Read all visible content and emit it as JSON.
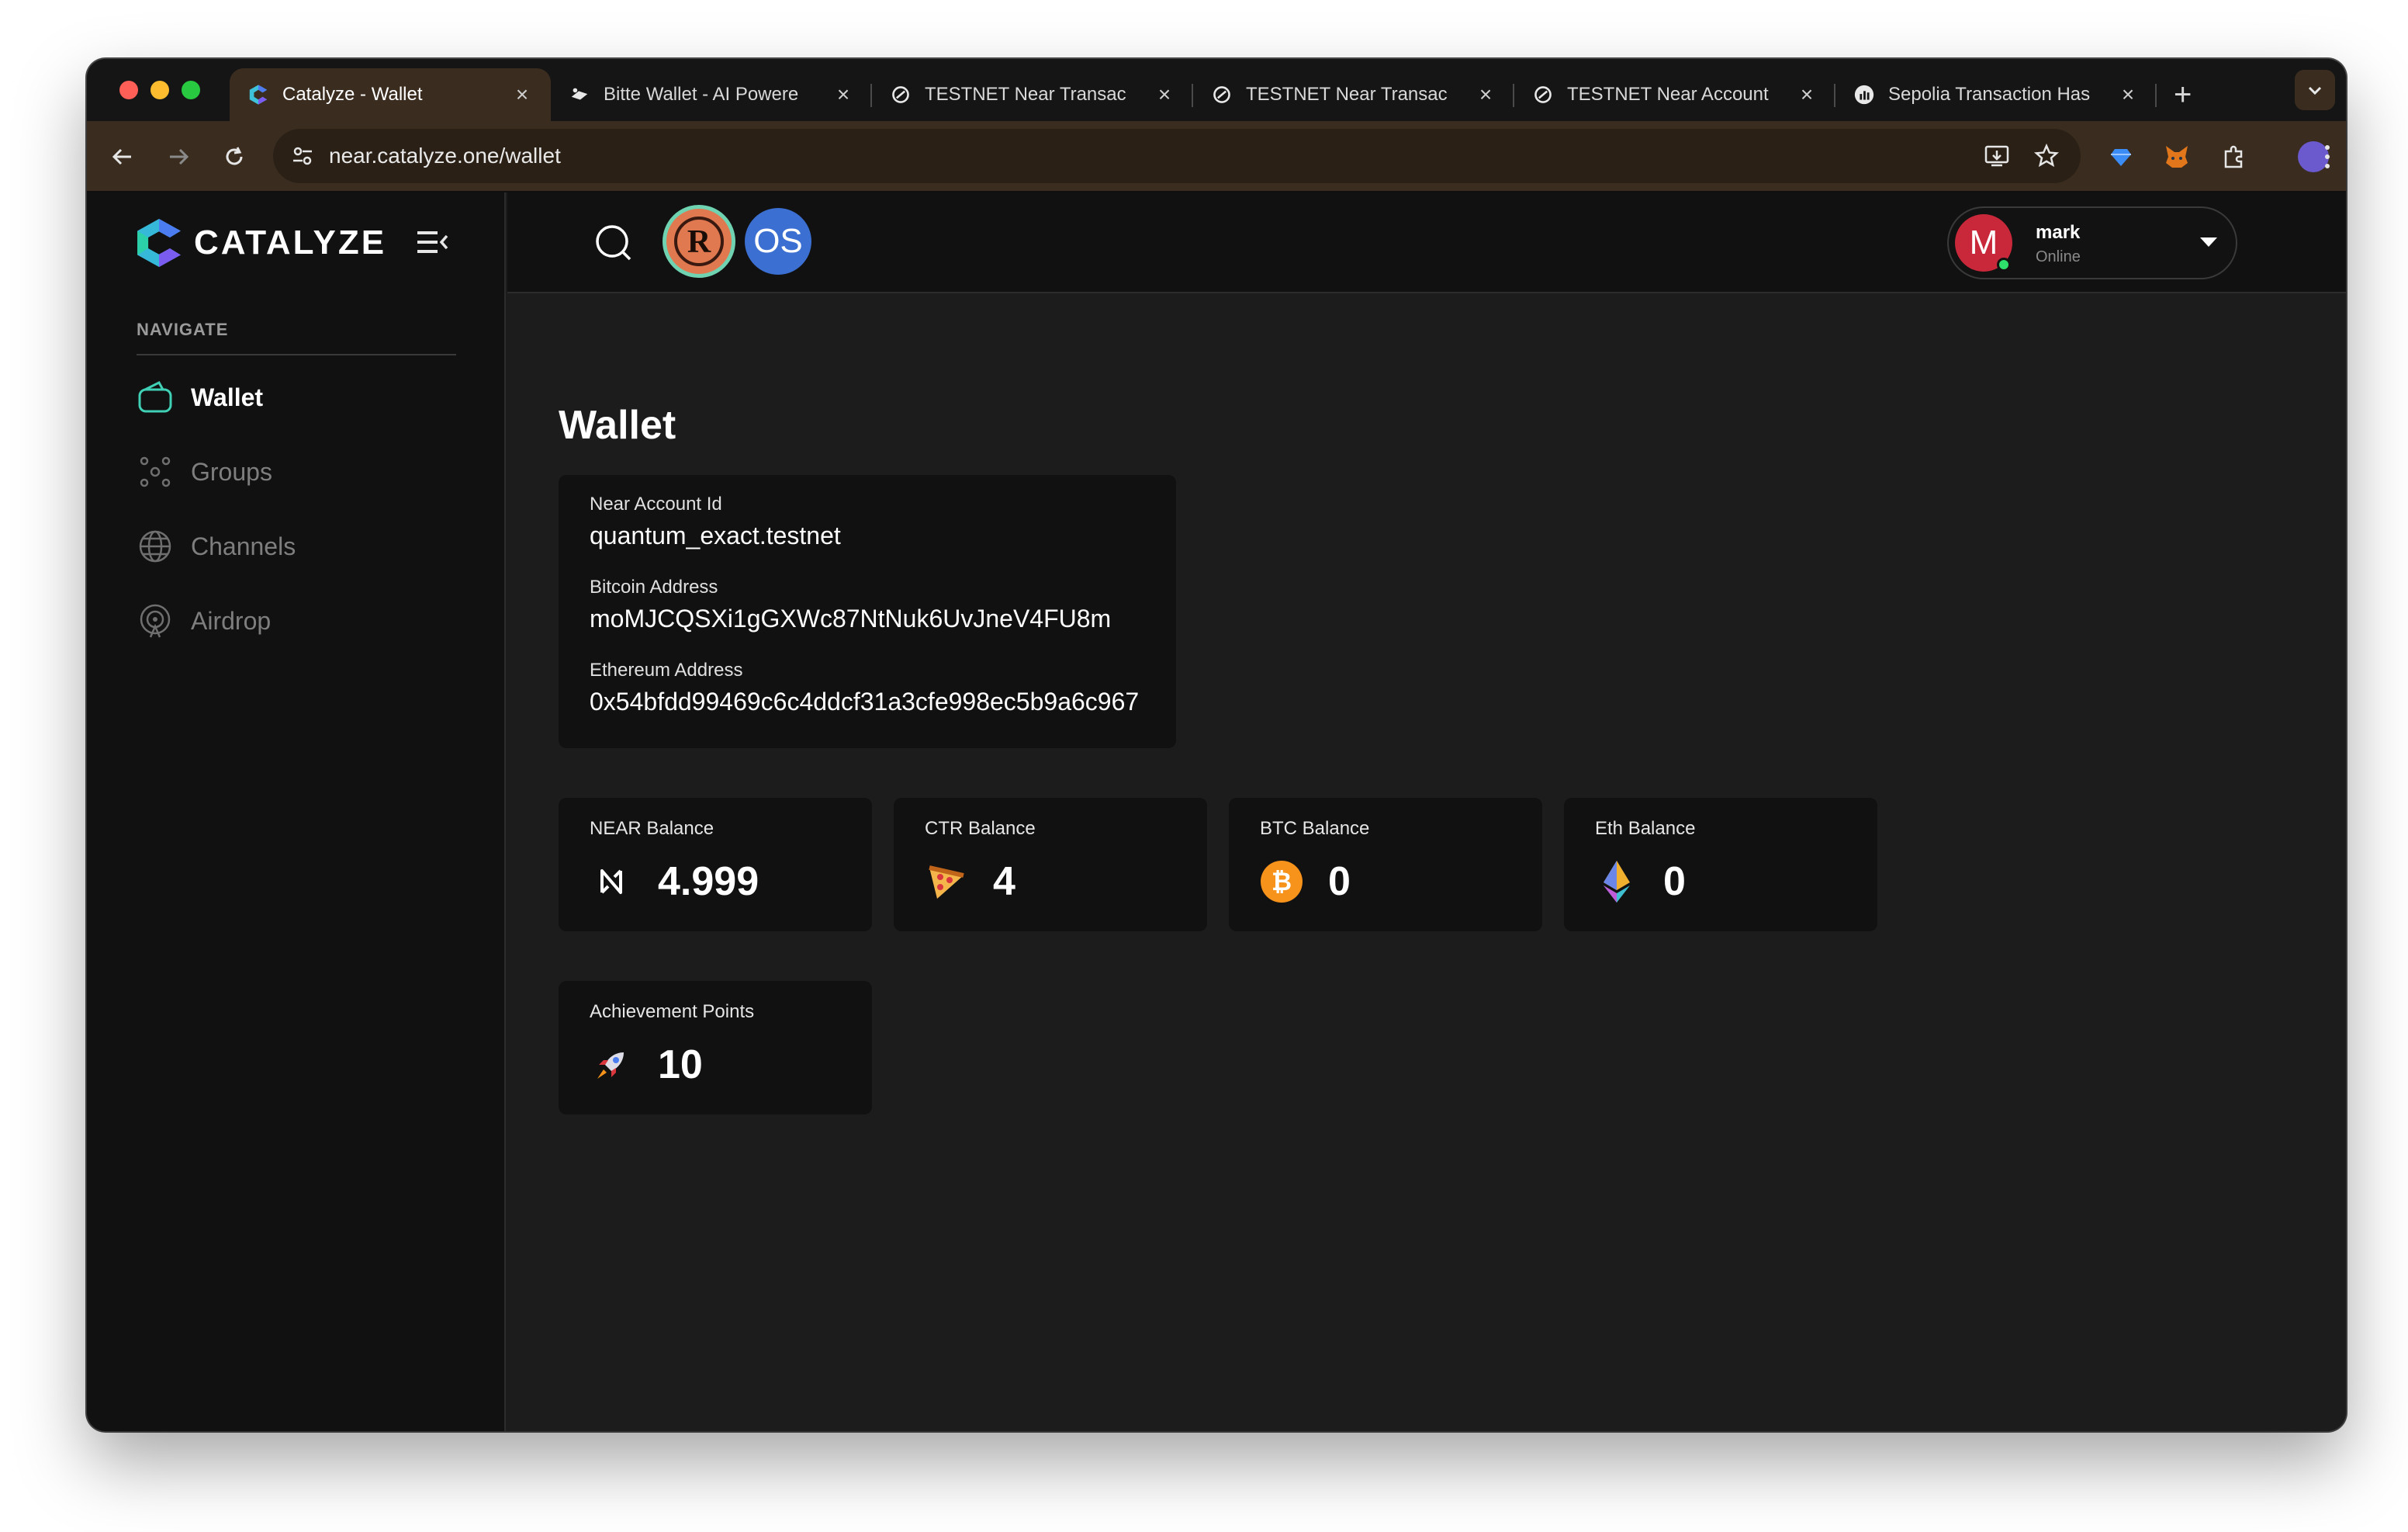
{
  "browser": {
    "tabs": [
      {
        "title": "Catalyze - Wallet",
        "favicon": "catalyze-logo-icon",
        "active": true
      },
      {
        "title": "Bitte Wallet - AI Powere",
        "favicon": "bitte-icon",
        "active": false
      },
      {
        "title": "TESTNET Near Transac",
        "favicon": "nearblocks-icon",
        "active": false
      },
      {
        "title": "TESTNET Near Transac",
        "favicon": "nearblocks-icon",
        "active": false
      },
      {
        "title": "TESTNET Near Account",
        "favicon": "nearblocks-icon",
        "active": false
      },
      {
        "title": "Sepolia Transaction Has",
        "favicon": "etherscan-icon",
        "active": false
      }
    ],
    "url": "near.catalyze.one/wallet",
    "accent": "#3a2d1f"
  },
  "sidebar": {
    "brand": "CATALYZE",
    "heading": "NAVIGATE",
    "items": [
      {
        "label": "Wallet",
        "icon": "wallet-icon",
        "active": true
      },
      {
        "label": "Groups",
        "icon": "groups-icon",
        "active": false
      },
      {
        "label": "Channels",
        "icon": "globe-icon",
        "active": false
      },
      {
        "label": "Airdrop",
        "icon": "airdrop-icon",
        "active": false
      }
    ]
  },
  "topbar": {
    "badge_os": "OS",
    "user": {
      "initial": "M",
      "name": "mark",
      "status": "Online"
    }
  },
  "main": {
    "title": "Wallet",
    "addresses": [
      {
        "label": "Near Account Id",
        "value": "quantum_exact.testnet"
      },
      {
        "label": "Bitcoin Address",
        "value": "moMJCQSXi1gGXWc87NtNuk6UvJneV4FU8m"
      },
      {
        "label": "Ethereum Address",
        "value": "0x54bfdd99469c6c4ddcf31a3cfe998ec5b9a6c967"
      }
    ],
    "balances": [
      {
        "label": "NEAR Balance",
        "value": "4.999",
        "icon": "near-icon"
      },
      {
        "label": "CTR Balance",
        "value": "4",
        "icon": "pizza-icon"
      },
      {
        "label": "BTC Balance",
        "value": "0",
        "icon": "bitcoin-icon"
      },
      {
        "label": "Eth Balance",
        "value": "0",
        "icon": "ethereum-icon"
      }
    ],
    "achievement": {
      "label": "Achievement Points",
      "value": "10",
      "icon": "rocket-icon"
    }
  }
}
